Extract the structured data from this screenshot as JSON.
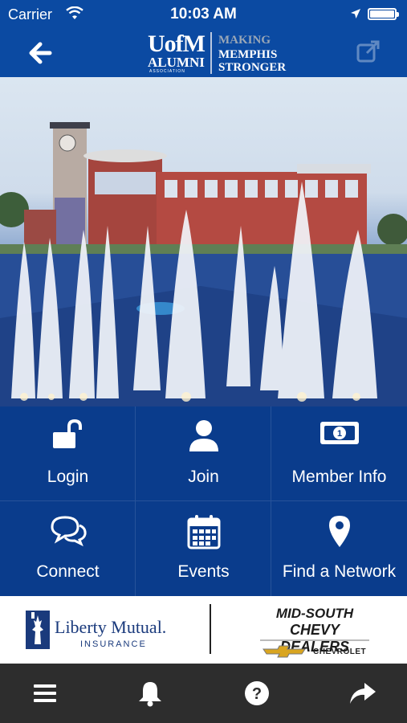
{
  "status_bar": {
    "carrier": "Carrier",
    "time": "10:03 AM"
  },
  "header": {
    "logo_um": "UofM",
    "logo_alumni": "ALUMNI",
    "logo_association": "ASSOCIATION",
    "tagline_line1": "MAKING",
    "tagline_line2": "MEMPHIS",
    "tagline_line3": "STRONGER",
    "back_icon": "arrow-left-icon",
    "share_icon": "external-share-icon"
  },
  "hero": {
    "icon": "campus-fountain-photo"
  },
  "tiles": [
    {
      "label": "Login",
      "icon": "unlock-icon"
    },
    {
      "label": "Join",
      "icon": "person-icon"
    },
    {
      "label": "Member Info",
      "icon": "card-icon"
    },
    {
      "label": "Connect",
      "icon": "chat-bubbles-icon"
    },
    {
      "label": "Events",
      "icon": "calendar-icon"
    },
    {
      "label": "Find a Network",
      "icon": "location-pin-icon"
    }
  ],
  "sponsors": {
    "liberty_name": "Liberty Mutual.",
    "liberty_sub": "INSURANCE",
    "chevy_line1": "MID-SOUTH",
    "chevy_line2": "CHEVY DEALERS",
    "chevy_brand": "CHEVROLET"
  },
  "tabbar": {
    "items": [
      "menu-icon",
      "bell-icon",
      "help-icon",
      "share-icon"
    ]
  },
  "colors": {
    "brand_blue": "#0b4aa2",
    "tile_blue": "#0a3c8c",
    "tabbar": "#2d2d2d"
  }
}
